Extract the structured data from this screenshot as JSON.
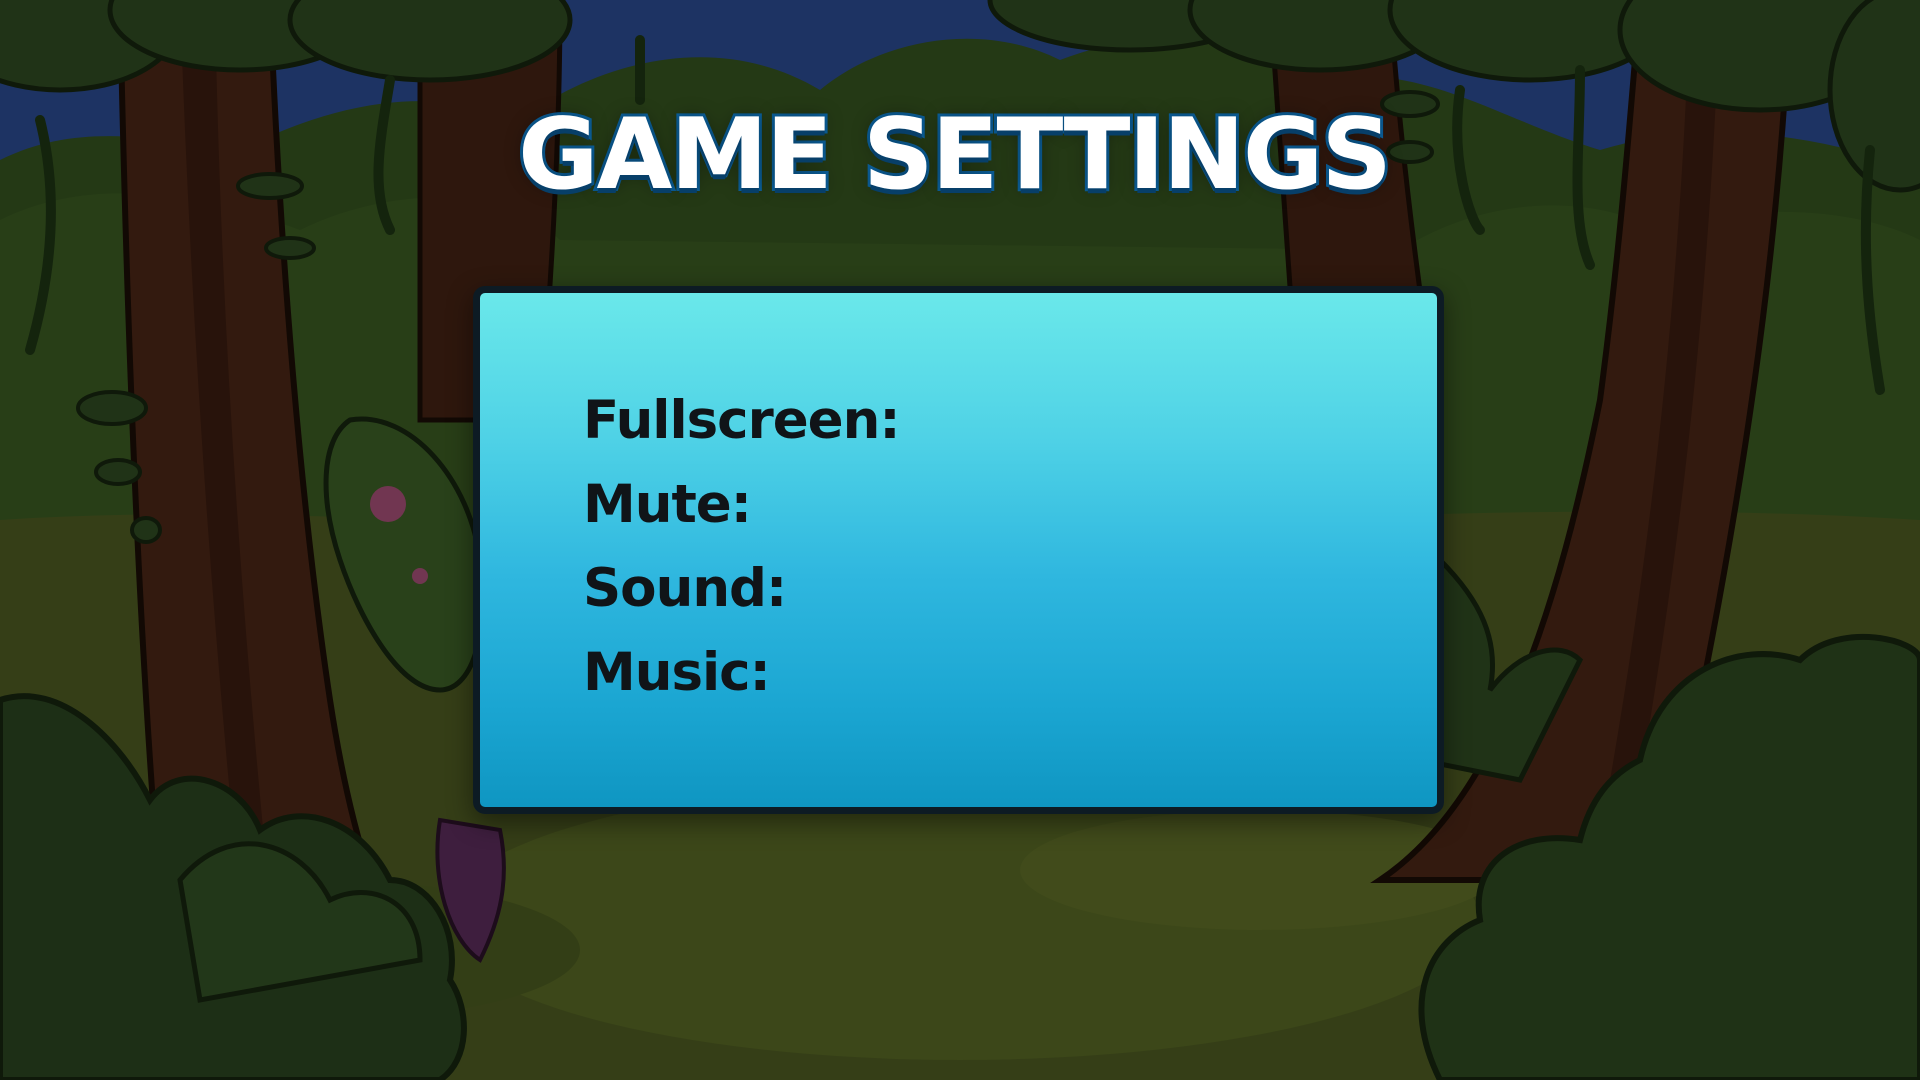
{
  "screen": {
    "title": "GAME SETTINGS",
    "title_color": "#ffffff",
    "title_outline_color": "#0b5f9a"
  },
  "settings_panel": {
    "background_top": "#6ae8ea",
    "background_bottom": "#0f96c2",
    "border_color": "#0d1b24",
    "options": [
      {
        "label": "Fullscreen:"
      },
      {
        "label": "Mute:"
      },
      {
        "label": "Sound:"
      },
      {
        "label": "Music:"
      }
    ]
  },
  "background": {
    "theme": "night forest",
    "sky_color": "#2a4a8e",
    "foliage_color": "#2f4a22",
    "trunk_color": "#4a2616",
    "ground_color": "#4c5a22"
  }
}
